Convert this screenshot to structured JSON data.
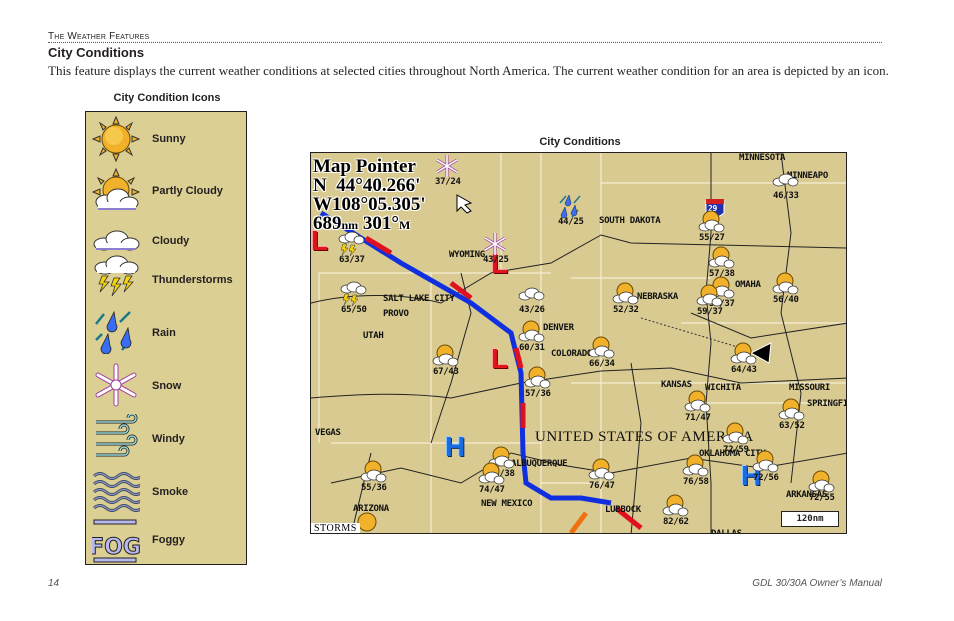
{
  "page": {
    "section_header": "The Weather Features",
    "title": "City Conditions",
    "intro": "This feature displays the current weather conditions at selected cities throughout North America. The current weather condition for an area is depicted by an icon.",
    "footer_page_number": "14",
    "footer_manual": "GDL 30/30A Owner’s Manual"
  },
  "legend": {
    "caption": "City Condition Icons",
    "items": [
      {
        "label": "Sunny",
        "icon": "sunny-icon"
      },
      {
        "label": "Partly Cloudy",
        "icon": "partly-cloudy-icon"
      },
      {
        "label": "Cloudy",
        "icon": "cloudy-icon"
      },
      {
        "label": "Thunderstorms",
        "icon": "thunderstorm-icon"
      },
      {
        "label": "Rain",
        "icon": "rain-icon"
      },
      {
        "label": "Snow",
        "icon": "snow-icon"
      },
      {
        "label": "Windy",
        "icon": "windy-icon"
      },
      {
        "label": "Smoke",
        "icon": "smoke-icon"
      },
      {
        "label": "Foggy",
        "icon": "fog-icon"
      }
    ]
  },
  "map": {
    "caption": "City Conditions",
    "pointer": {
      "title": "Map Pointer",
      "lat_prefix": "N",
      "lat": "44°40.266'",
      "lon_prefix": "W",
      "lon": "108°05.305'",
      "distance": "689",
      "distance_unit": "nm",
      "bearing": "301°",
      "bearing_unit": "M"
    },
    "country_label": "UNITED STATES OF AMERICA",
    "storms_tag": "STORMS",
    "scale": "120nm",
    "interstate_shield": "29",
    "labels": [
      {
        "text": "MINNESOTA"
      },
      {
        "text": "MINNEAPO"
      },
      {
        "text": "SOUTH DAKOTA"
      },
      {
        "text": "WYOMING"
      },
      {
        "text": "SALT LAKE CITY"
      },
      {
        "text": "PROVO"
      },
      {
        "text": "UTAH"
      },
      {
        "text": "DENVER"
      },
      {
        "text": "COLORADO"
      },
      {
        "text": "NEBRASKA"
      },
      {
        "text": "OMAHA"
      },
      {
        "text": "KANSAS"
      },
      {
        "text": "WICHITA"
      },
      {
        "text": "MISSOURI"
      },
      {
        "text": "SPRINGFIE"
      },
      {
        "text": "VEGAS"
      },
      {
        "text": "ARIZONA"
      },
      {
        "text": "ALBUQUERQUE"
      },
      {
        "text": "NEW MEXICO"
      },
      {
        "text": "LUBBOCK"
      },
      {
        "text": "OKLAHOMA CITY"
      },
      {
        "text": "ARKANSAS"
      },
      {
        "text": "DALLAS"
      }
    ],
    "cities": [
      {
        "condition": "snow",
        "temps": "37/24"
      },
      {
        "condition": "rain",
        "temps": "44/25"
      },
      {
        "condition": "cloudy",
        "temps": "46/33"
      },
      {
        "condition": "thunderstorms",
        "temps": "63/37"
      },
      {
        "condition": "snow",
        "temps": "43/25"
      },
      {
        "condition": "partly-cloudy",
        "temps": "55/27"
      },
      {
        "condition": "partly-cloudy",
        "temps": "57/38"
      },
      {
        "condition": "partly-cloudy",
        "temps": "59/37"
      },
      {
        "condition": "partly-cloudy",
        "temps": "59/37"
      },
      {
        "condition": "partly-cloudy",
        "temps": "56/40"
      },
      {
        "condition": "thunderstorms",
        "temps": "65/50"
      },
      {
        "condition": "cloudy",
        "temps": "43/26"
      },
      {
        "condition": "partly-cloudy",
        "temps": "52/32"
      },
      {
        "condition": "partly-cloudy",
        "temps": "60/31"
      },
      {
        "condition": "partly-cloudy",
        "temps": "67/43"
      },
      {
        "condition": "partly-cloudy",
        "temps": "66/34"
      },
      {
        "condition": "partly-cloudy",
        "temps": "57/36"
      },
      {
        "condition": "partly-cloudy",
        "temps": "64/43"
      },
      {
        "condition": "partly-cloudy",
        "temps": "71/47"
      },
      {
        "condition": "partly-cloudy",
        "temps": "63/52"
      },
      {
        "condition": "partly-cloudy",
        "temps": "55/36"
      },
      {
        "condition": "partly-cloudy",
        "temps": "68/38"
      },
      {
        "condition": "partly-cloudy",
        "temps": "74/47"
      },
      {
        "condition": "partly-cloudy",
        "temps": "76/47"
      },
      {
        "condition": "partly-cloudy",
        "temps": "72/59"
      },
      {
        "condition": "partly-cloudy",
        "temps": "76/58"
      },
      {
        "condition": "partly-cloudy",
        "temps": "72/56"
      },
      {
        "condition": "partly-cloudy",
        "temps": "72/55"
      },
      {
        "condition": "partly-cloudy",
        "temps": "82/62"
      },
      {
        "condition": "sunny",
        "temps": ""
      }
    ],
    "colors": {
      "land": "#d8ca91",
      "cold_front": "#1030e0",
      "warm_front": "#e01020",
      "high": "#1b6be0",
      "low": "#e0141b"
    }
  }
}
